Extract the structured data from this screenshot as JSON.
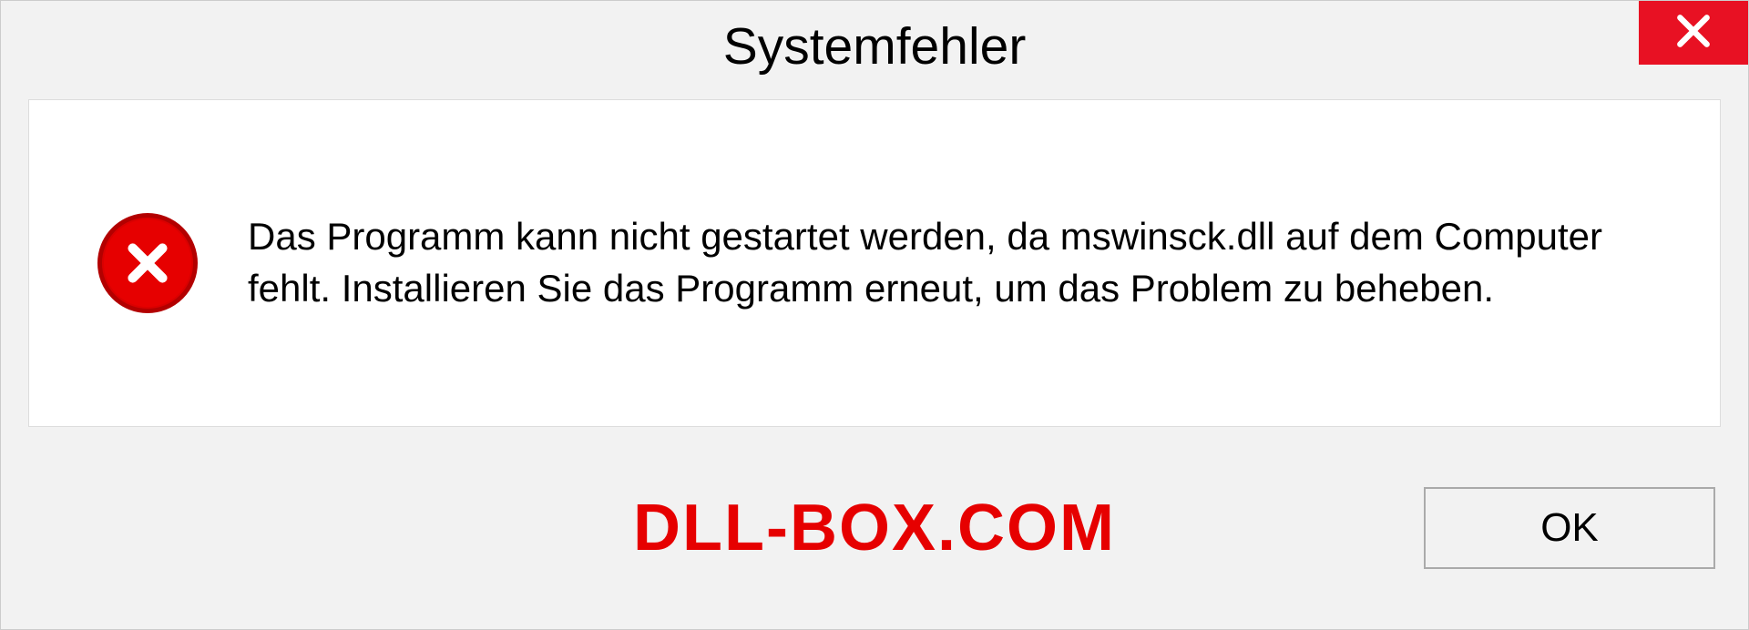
{
  "dialog": {
    "title": "Systemfehler",
    "message": "Das Programm kann nicht gestartet werden, da mswinsck.dll auf dem Computer fehlt. Installieren Sie das Programm erneut, um das Problem zu beheben.",
    "ok_label": "OK"
  },
  "watermark": "DLL-BOX.COM"
}
